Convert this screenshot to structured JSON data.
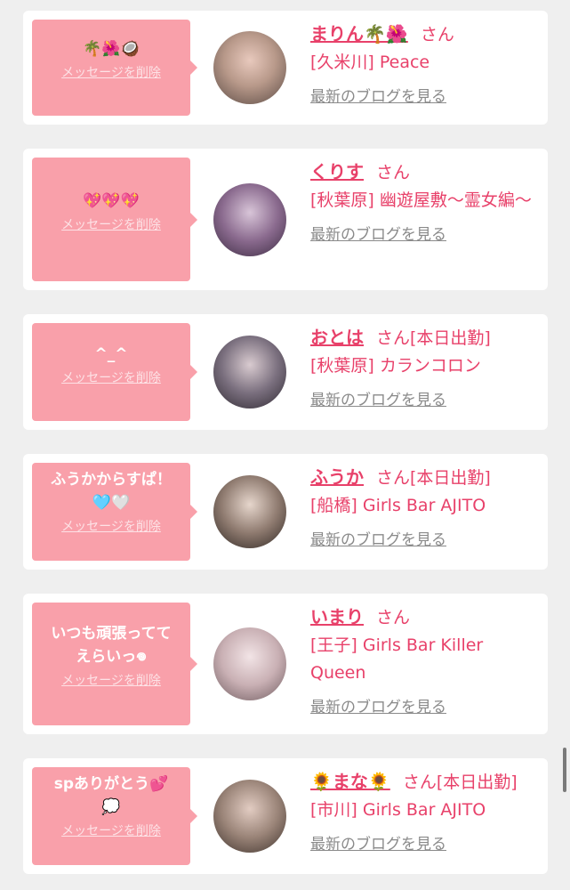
{
  "cards": [
    {
      "message": "🌴🌺🥥",
      "delete_label": "メッセージを削除",
      "name": "まりん🌴🌺",
      "honorific": "さん",
      "status": "",
      "shop": "[久米川] Peace",
      "blog_label": "最新のブログを見る"
    },
    {
      "message": "💖💖💖",
      "delete_label": "メッセージを削除",
      "name": "くりす",
      "honorific": "さん",
      "status": "",
      "shop": "[秋葉原] 幽遊屋敷〜霊女編〜",
      "blog_label": "最新のブログを見る"
    },
    {
      "message": "^_^",
      "delete_label": "メッセージを削除",
      "name": "おとは",
      "honorific": "さん",
      "status": "[本日出勤]",
      "shop": "[秋葉原] カランコロン",
      "blog_label": "最新のブログを見る"
    },
    {
      "message": "ふうかからすぱ！\n🩵🤍",
      "delete_label": "メッセージを削除",
      "name": "ふうか",
      "honorific": "さん",
      "status": "[本日出勤]",
      "shop": "[船橋] Girls Bar AJITO",
      "blog_label": "最新のブログを見る"
    },
    {
      "message": "いつも頑張ってて\nえらいっ𖦹",
      "delete_label": "メッセージを削除",
      "name": "いまり",
      "honorific": "さん",
      "status": "",
      "shop": "[王子] Girls Bar Killer Queen",
      "blog_label": "最新のブログを見る"
    },
    {
      "message": "spありがとう💕\n💭",
      "delete_label": "メッセージを削除",
      "name": "🌻まな🌻",
      "honorific": "さん",
      "status": "[本日出勤]",
      "shop": "[市川] Girls Bar AJITO",
      "blog_label": "最新のブログを見る"
    }
  ]
}
